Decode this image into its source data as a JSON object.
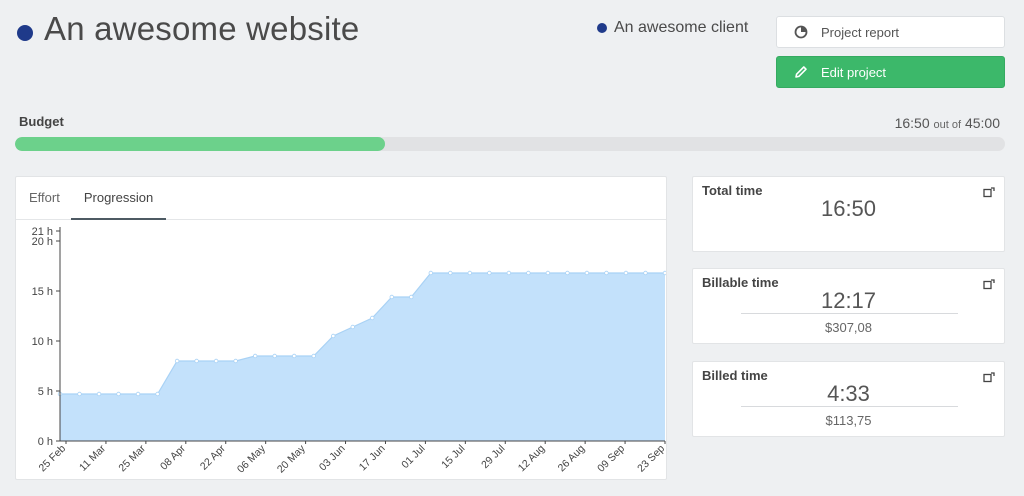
{
  "header": {
    "title": "An awesome website",
    "client": "An awesome client"
  },
  "actions": {
    "project_report": "Project report",
    "edit_project": "Edit project"
  },
  "budget": {
    "label": "Budget",
    "used": "16:50",
    "out_of_label": "out of",
    "total": "45:00",
    "progress_fraction": 0.374
  },
  "chart_tabs": [
    {
      "label": "Effort",
      "active": false
    },
    {
      "label": "Progression",
      "active": true
    }
  ],
  "chart_data": {
    "type": "area",
    "y_ticks": [
      "0 h",
      "5 h",
      "10 h",
      "15 h",
      "20 h",
      "21 h"
    ],
    "y_tick_values": [
      0,
      5,
      10,
      15,
      20,
      21
    ],
    "ylim": [
      0,
      21
    ],
    "x_tick_labels": [
      "25 Feb",
      "11 Mar",
      "25 Mar",
      "08 Apr",
      "22 Apr",
      "06 May",
      "20 May",
      "03 Jun",
      "17 Jun",
      "01 Jul",
      "15 Jul",
      "29 Jul",
      "12 Aug",
      "26 Aug",
      "09 Sep",
      "23 Sep"
    ],
    "values": [
      4.7,
      4.7,
      4.7,
      4.7,
      4.7,
      4.7,
      8.0,
      8.0,
      8.0,
      8.0,
      8.5,
      8.5,
      8.5,
      8.5,
      10.5,
      11.4,
      12.3,
      14.4,
      14.4,
      16.8,
      16.8,
      16.8,
      16.8,
      16.8,
      16.8,
      16.8,
      16.8,
      16.8,
      16.8,
      16.8,
      16.8,
      16.8
    ],
    "fill_color": "#c3e1fb",
    "line_color": "#a9d2f5"
  },
  "stats": {
    "total": {
      "title": "Total time",
      "value": "16:50"
    },
    "billable": {
      "title": "Billable time",
      "value": "12:17",
      "amount": "$307,08"
    },
    "billed": {
      "title": "Billed time",
      "value": "4:33",
      "amount": "$113,75"
    }
  },
  "icons": {
    "report": "pie-chart-icon",
    "edit": "pencil-icon",
    "expand": "expand-icon"
  },
  "colors": {
    "brand_dot": "#1f3a8a",
    "primary_button": "#3cb86a",
    "progress_fill": "#6cd18b"
  }
}
